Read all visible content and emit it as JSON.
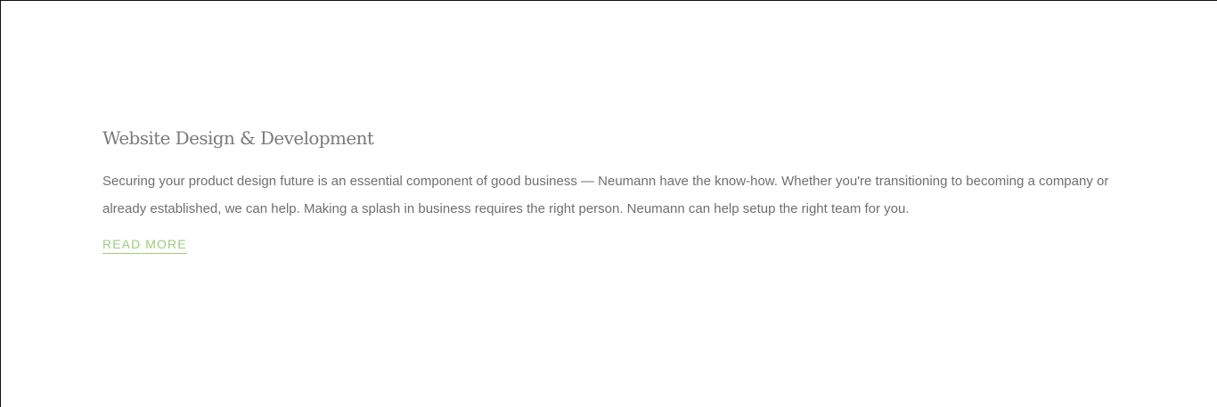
{
  "section": {
    "title": "Website Design & Development",
    "body": "Securing your product design future is an essential component of good business — Neumann have the know-how. Whether you're transitioning to becoming a company or already established, we can help. Making a splash in business requires the right person. Neumann can help setup the right team for you.",
    "read_more_label": "READ MORE"
  },
  "colors": {
    "title": "#7a7a7a",
    "body": "#6f6f6f",
    "accent": "#9acd7a",
    "frame_border": "#111111",
    "background": "#ffffff"
  }
}
